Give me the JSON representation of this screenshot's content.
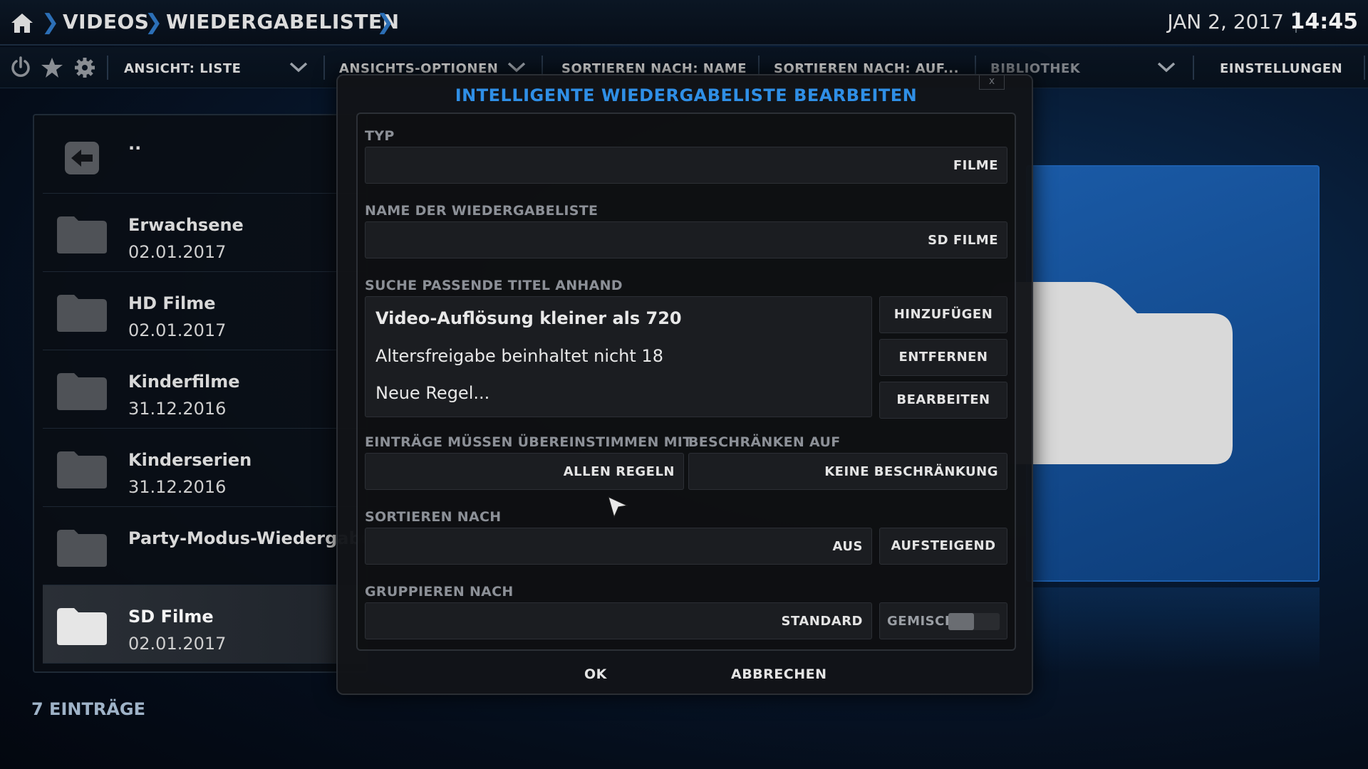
{
  "breadcrumb": {
    "items": [
      "VIDEOS",
      "WIEDERGABELISTEN"
    ]
  },
  "clock": {
    "date": "JAN 2, 2017",
    "time": "14:45"
  },
  "toolbar": {
    "view": "ANSICHT: LISTE",
    "view_options": "ANSICHTS-OPTIONEN",
    "sort_name": "SORTIEREN NACH: NAME",
    "sort_order": "SORTIEREN NACH: AUF...",
    "library": "BIBLIOTHEK",
    "settings": "EINSTELLUNGEN"
  },
  "list": {
    "back_label": "..",
    "items": [
      {
        "name": "Erwachsene",
        "date": "02.01.2017"
      },
      {
        "name": "HD Filme",
        "date": "02.01.2017"
      },
      {
        "name": "Kinderfilme",
        "date": "31.12.2016"
      },
      {
        "name": "Kinderserien",
        "date": "31.12.2016"
      },
      {
        "name": "Party-Modus-Wiedergabeliste",
        "date": ""
      },
      {
        "name": "SD Filme",
        "date": "02.01.2017"
      }
    ],
    "count_label": "7 EINTRÄGE"
  },
  "dialog": {
    "title": "INTELLIGENTE WIEDERGABELISTE BEARBEITEN",
    "close_label": "x",
    "type_label": "TYP",
    "type_value": "FILME",
    "name_label": "NAME DER WIEDERGABELISTE",
    "name_value": "SD FILME",
    "rules_label": "SUCHE PASSENDE TITEL ANHAND",
    "rules": [
      "Video-Auflösung kleiner als 720",
      "Altersfreigabe beinhaltet nicht 18",
      "Neue Regel..."
    ],
    "add_button": "HINZUFÜGEN",
    "remove_button": "ENTFERNEN",
    "edit_button": "BEARBEITEN",
    "match_label": "EINTRÄGE MÜSSEN ÜBEREINSTIMMEN MIT",
    "match_value": "ALLEN REGELN",
    "limit_label": "BESCHRÄNKEN AUF",
    "limit_value": "KEINE BESCHRÄNKUNG",
    "sort_label": "SORTIEREN NACH",
    "sort_value": "AUS",
    "sort_direction": "AUFSTEIGEND",
    "group_label": "GRUPPIEREN NACH",
    "group_value": "STANDARD",
    "mixed_label": "GEMISCHT",
    "mixed_enabled": false,
    "ok_button": "OK",
    "cancel_button": "ABBRECHEN"
  },
  "colors": {
    "accent": "#2f8fe6",
    "preview": "#1a5aa6"
  }
}
